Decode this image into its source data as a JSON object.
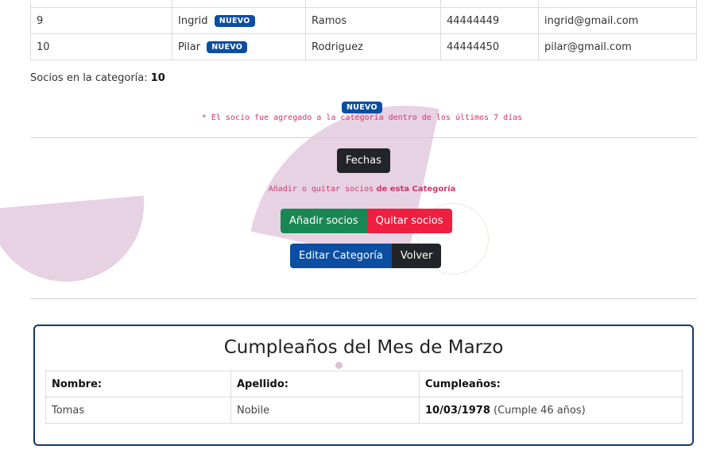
{
  "members_table": {
    "rows": [
      {
        "num": "9",
        "name": "Ingrid",
        "badge": "NUEVO",
        "surname": "Ramos",
        "dni": "44444449",
        "email": "ingrid@gmail.com"
      },
      {
        "num": "10",
        "name": "Pilar",
        "badge": "NUEVO",
        "surname": "Rodriguez",
        "dni": "44444450",
        "email": "pilar@gmail.com"
      }
    ]
  },
  "summary": {
    "count_label": "Socios en la categoría:",
    "count_value": "10"
  },
  "legend": {
    "badge": "NUEVO",
    "note": "* El socio fue agregado a la categoría dentro de los últimos 7 días"
  },
  "actions": {
    "fechas": "Fechas",
    "add_remove_prefix": "Añadir o quitar socios",
    "add_remove_bold": "de esta Categoría",
    "add": "Añadir socios",
    "remove": "Quitar socios",
    "edit": "Editar Categoría",
    "back": "Volver"
  },
  "birthdays": {
    "title": "Cumpleaños del Mes de Marzo",
    "headers": [
      "Nombre:",
      "Apellido:",
      "Cumpleaños:"
    ],
    "rows": [
      {
        "name": "Tomas",
        "surname": "Nobile",
        "date": "10/03/1978",
        "extra": "(Cumple 46 años)"
      }
    ]
  },
  "colors": {
    "badge": "#0b4ea2",
    "note": "#d6336c",
    "add": "#198754",
    "remove": "#ee1f3f",
    "edit": "#0b4ea2",
    "dark": "#212529",
    "card_border": "#133a67",
    "decor": "#e7d2e4"
  }
}
